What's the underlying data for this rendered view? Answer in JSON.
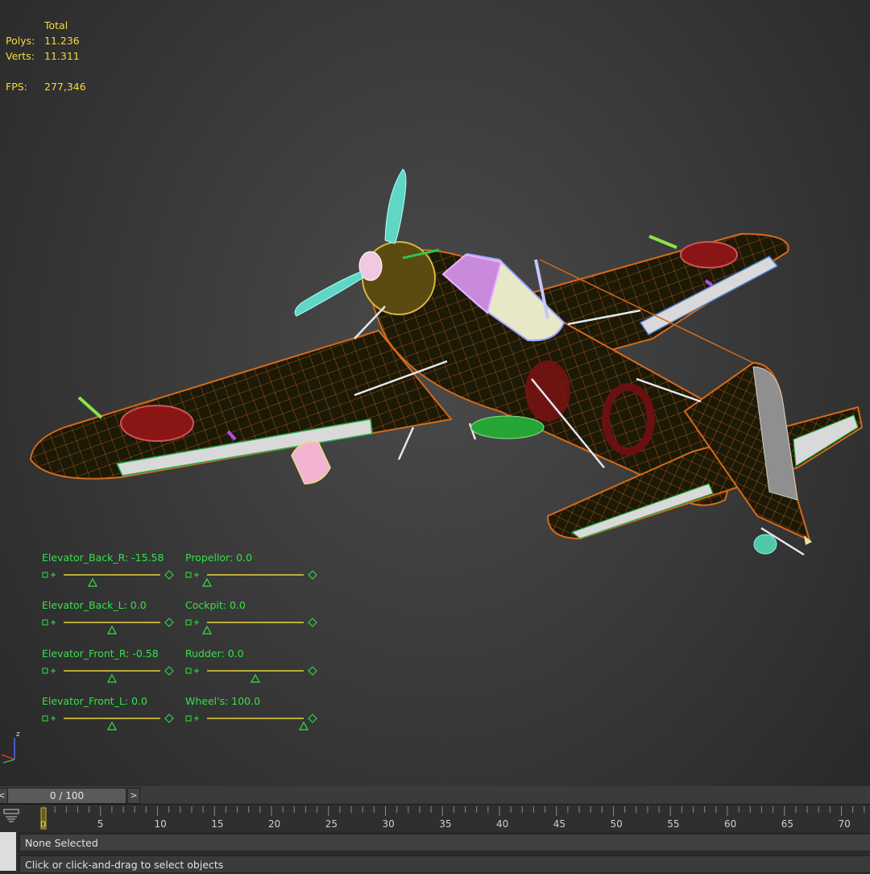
{
  "stats": {
    "header": "Total",
    "polys_label": "Polys:",
    "polys_value": "11.236",
    "verts_label": "Verts:",
    "verts_value": "11.311",
    "fps_label": "FPS:",
    "fps_value": "277,346"
  },
  "sliders": [
    {
      "label": "Elevator_Back_R: -15.58",
      "value": -15.58,
      "handle_fraction": 0.3
    },
    {
      "label": "Elevator_Back_L: 0.0",
      "value": 0.0,
      "handle_fraction": 0.5
    },
    {
      "label": "Elevator_Front_R: -0.58",
      "value": -0.58,
      "handle_fraction": 0.5
    },
    {
      "label": "Elevator_Front_L: 0.0",
      "value": 0.0,
      "handle_fraction": 0.5
    },
    {
      "label": "Propellor: 0.0",
      "value": 0.0,
      "handle_fraction": 0.0
    },
    {
      "label": "Cockpit: 0.0",
      "value": 0.0,
      "handle_fraction": 0.0
    },
    {
      "label": "Rudder: 0.0",
      "value": 0.0,
      "handle_fraction": 0.5
    },
    {
      "label": "Wheel's: 100.0",
      "value": 100.0,
      "handle_fraction": 1.0
    }
  ],
  "timeline": {
    "prev": "<",
    "next": ">",
    "frame": "0 / 100",
    "ticks": [
      "5",
      "10",
      "15",
      "20",
      "25",
      "30",
      "35",
      "40",
      "45",
      "50",
      "55",
      "60",
      "65",
      "70"
    ],
    "current_frame": "0"
  },
  "gizmo": {
    "z": "z"
  },
  "status": {
    "selection": "None Selected",
    "prompt": "Click or click-and-drag to select objects"
  },
  "colors": {
    "stats_text": "#f2dd3a",
    "slider_text": "#33e14a",
    "wire": "#d46a1c",
    "fuselage": "#1d1a08",
    "roundel": "#8a1515"
  }
}
